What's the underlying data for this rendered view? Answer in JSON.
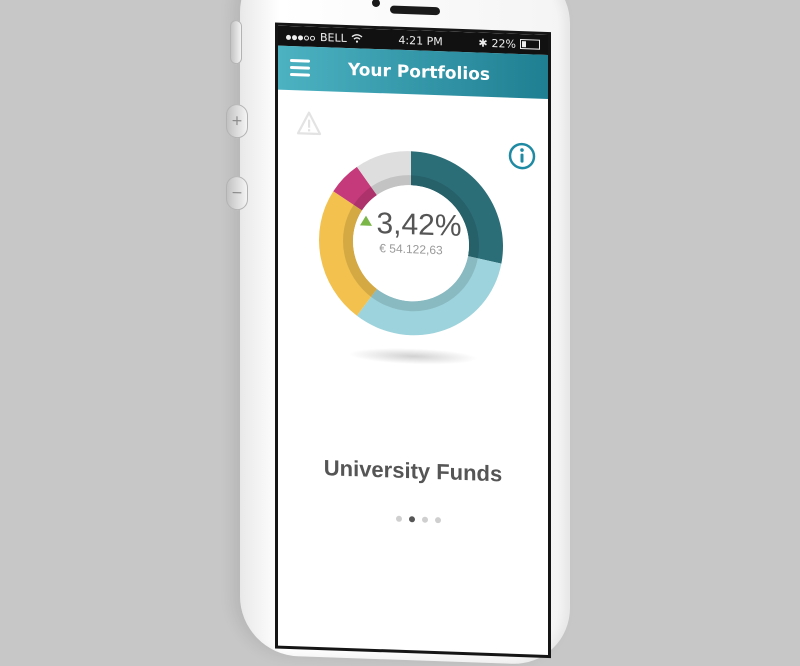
{
  "status_bar": {
    "carrier": "BELL",
    "time": "4:21 PM",
    "battery_percent": "22%",
    "signal_dots": 5,
    "signal_filled": 3
  },
  "navbar": {
    "title": "Your Portfolios",
    "menu_icon": "hamburger-menu-icon",
    "bg_start": "#4cb2c2",
    "bg_end": "#1f7f92"
  },
  "portfolio": {
    "change_percent": "3,42%",
    "value": "€ 54.122,63",
    "trend": "up",
    "name": "University Funds",
    "allocation": [
      {
        "value": 28,
        "color": "#2c6e78"
      },
      {
        "value": 32,
        "color": "#9dd3dc"
      },
      {
        "value": 24,
        "color": "#f2c14e"
      },
      {
        "value": 6,
        "color": "#c53a7a"
      },
      {
        "value": 10,
        "color": "#dedede"
      }
    ]
  },
  "pager": {
    "count": 4,
    "active_index": 1
  },
  "icons": {
    "alert": "warning-triangle-icon",
    "info": "info-circle-icon"
  }
}
